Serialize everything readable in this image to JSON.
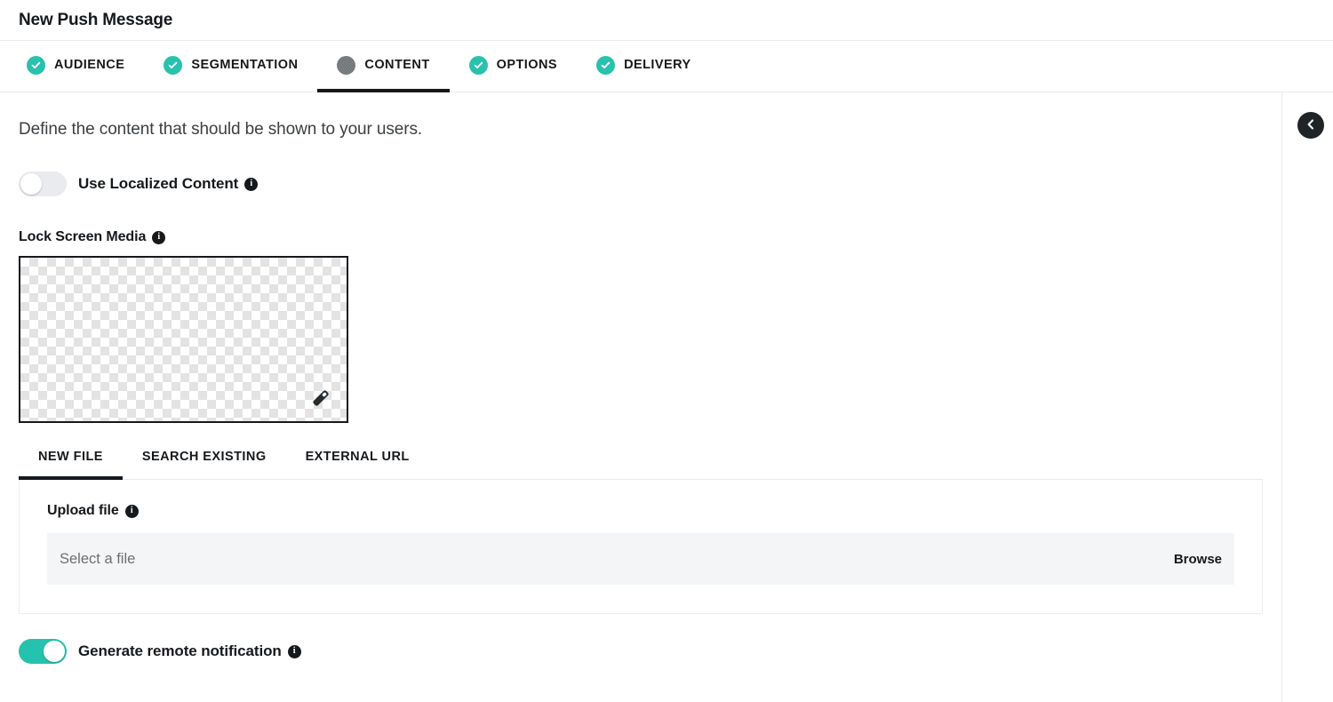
{
  "header": {
    "title": "New Push Message"
  },
  "steps": [
    {
      "label": "AUDIENCE",
      "state": "done",
      "icon": "check-circle-icon"
    },
    {
      "label": "SEGMENTATION",
      "state": "done",
      "icon": "check-circle-icon"
    },
    {
      "label": "CONTENT",
      "state": "current",
      "icon": "current-step-icon"
    },
    {
      "label": "OPTIONS",
      "state": "done",
      "icon": "check-circle-icon"
    },
    {
      "label": "DELIVERY",
      "state": "done",
      "icon": "check-circle-icon"
    }
  ],
  "content": {
    "intro": "Define the content that should be shown to your users.",
    "localized_toggle": {
      "label": "Use Localized Content",
      "state": "off",
      "info": "i"
    },
    "lock_screen_media": {
      "label": "Lock Screen Media",
      "info": "i",
      "edit_icon": "pencil-icon",
      "preview": "empty-transparent"
    },
    "media_tabs": [
      {
        "label": "NEW FILE",
        "active": true
      },
      {
        "label": "SEARCH EXISTING",
        "active": false
      },
      {
        "label": "EXTERNAL URL",
        "active": false
      }
    ],
    "upload": {
      "label": "Upload file",
      "info": "i",
      "placeholder": "Select a file",
      "browse_label": "Browse"
    },
    "remote_toggle": {
      "label": "Generate remote notification",
      "state": "on",
      "info": "i"
    }
  },
  "side_panel": {
    "collapse_icon": "chevron-left-icon"
  },
  "colors": {
    "accent_teal": "#25c2ae",
    "ink": "#16191c",
    "muted": "#6b7073",
    "field_bg": "#f4f5f7",
    "border": "#e8eaed"
  }
}
